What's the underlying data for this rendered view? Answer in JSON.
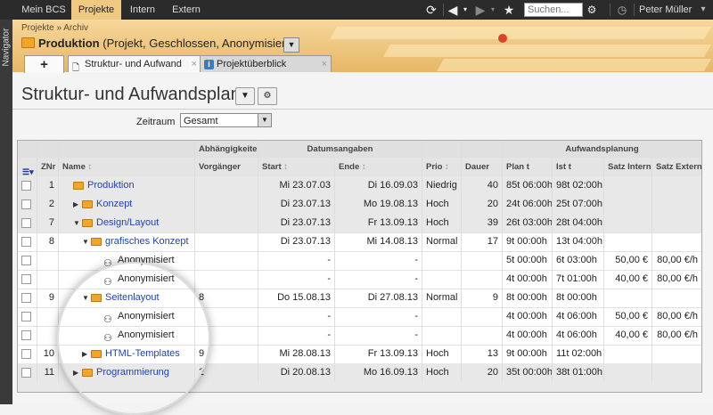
{
  "topnav": {
    "tabs": [
      {
        "label": "Mein BCS",
        "active": false
      },
      {
        "label": "Projekte",
        "active": true
      },
      {
        "label": "Intern",
        "active": false
      },
      {
        "label": "Extern",
        "active": false
      }
    ],
    "search_placeholder": "Suchen...",
    "user": "Peter Müller"
  },
  "sidebar": {
    "label": "Navigator"
  },
  "header": {
    "breadcrumb": "Projekte » Archiv",
    "title": "Produktion",
    "subtitle": "(Projekt, Geschlossen, Anonymisiert)"
  },
  "tabs": [
    {
      "label": "Struktur- und Aufwand",
      "active": true
    },
    {
      "label": "Projektüberblick",
      "active": false
    }
  ],
  "page": {
    "title": "Struktur- und Aufwandsplan",
    "filter_label": "Zeitraum",
    "filter_value": "Gesamt"
  },
  "grid": {
    "group_headers": [
      "Abhängigkeiten",
      "Datumsangaben",
      "Aufwandsplanung"
    ],
    "columns": [
      "ZNr",
      "Name",
      "Vorgänger",
      "Start",
      "Ende",
      "Prio",
      "Dauer",
      "Plan t",
      "Ist t",
      "Satz Intern",
      "Satz Extern"
    ],
    "rows": [
      {
        "znr": "1",
        "name": "Produktion",
        "vorg": "",
        "start": "Mi 23.07.03",
        "ende": "Di 16.09.03",
        "prio": "Niedrig",
        "dauer": "40",
        "plan": "85t 06:00h",
        "ist": "98t 02:00h",
        "satz_int": "",
        "satz_ext": ""
      },
      {
        "znr": "2",
        "name": "Konzept",
        "vorg": "",
        "start": "Di 23.07.13",
        "ende": "Mo 19.08.13",
        "prio": "Hoch",
        "dauer": "20",
        "plan": "24t 06:00h",
        "ist": "25t 07:00h",
        "satz_int": "",
        "satz_ext": ""
      },
      {
        "znr": "7",
        "name": "Design/Layout",
        "vorg": "",
        "start": "Di 23.07.13",
        "ende": "Fr 13.09.13",
        "prio": "Hoch",
        "dauer": "39",
        "plan": "26t 03:00h",
        "ist": "28t 04:00h",
        "satz_int": "",
        "satz_ext": ""
      },
      {
        "znr": "8",
        "name": "grafisches Konzept",
        "vorg": "",
        "start": "Di 23.07.13",
        "ende": "Mi 14.08.13",
        "prio": "Normal",
        "dauer": "17",
        "plan": "9t 00:00h",
        "ist": "13t 04:00h",
        "satz_int": "",
        "satz_ext": ""
      },
      {
        "znr": "",
        "name": "Anonymisiert",
        "vorg": "",
        "start": "-",
        "ende": "-",
        "prio": "",
        "dauer": "",
        "plan": "5t 00:00h",
        "ist": "6t 03:00h",
        "satz_int": "50,00 €",
        "satz_ext": "80,00 €/h"
      },
      {
        "znr": "",
        "name": "Anonymisiert",
        "vorg": "",
        "start": "-",
        "ende": "-",
        "prio": "",
        "dauer": "",
        "plan": "4t 00:00h",
        "ist": "7t 01:00h",
        "satz_int": "40,00 €",
        "satz_ext": "80,00 €/h"
      },
      {
        "znr": "9",
        "name": "Seitenlayout",
        "vorg": "8",
        "start": "Do 15.08.13",
        "ende": "Di 27.08.13",
        "prio": "Normal",
        "dauer": "9",
        "plan": "8t 00:00h",
        "ist": "8t 00:00h",
        "satz_int": "",
        "satz_ext": ""
      },
      {
        "znr": "",
        "name": "Anonymisiert",
        "vorg": "",
        "start": "-",
        "ende": "-",
        "prio": "",
        "dauer": "",
        "plan": "4t 00:00h",
        "ist": "4t 06:00h",
        "satz_int": "50,00 €",
        "satz_ext": "80,00 €/h"
      },
      {
        "znr": "",
        "name": "Anonymisiert",
        "vorg": "",
        "start": "-",
        "ende": "-",
        "prio": "",
        "dauer": "",
        "plan": "4t 00:00h",
        "ist": "4t 06:00h",
        "satz_int": "40,00 €",
        "satz_ext": "80,00 €/h"
      },
      {
        "znr": "10",
        "name": "HTML-Templates",
        "vorg": "9",
        "start": "Mi 28.08.13",
        "ende": "Fr 13.09.13",
        "prio": "Hoch",
        "dauer": "13",
        "plan": "9t 00:00h",
        "ist": "11t 02:00h",
        "satz_int": "",
        "satz_ext": ""
      },
      {
        "znr": "11",
        "name": "Programmierung",
        "vorg": "2",
        "start": "Di 20.08.13",
        "ende": "Mo 16.09.13",
        "prio": "Hoch",
        "dauer": "20",
        "plan": "35t 00:00h",
        "ist": "38t 01:00h",
        "satz_int": "",
        "satz_ext": ""
      }
    ]
  }
}
